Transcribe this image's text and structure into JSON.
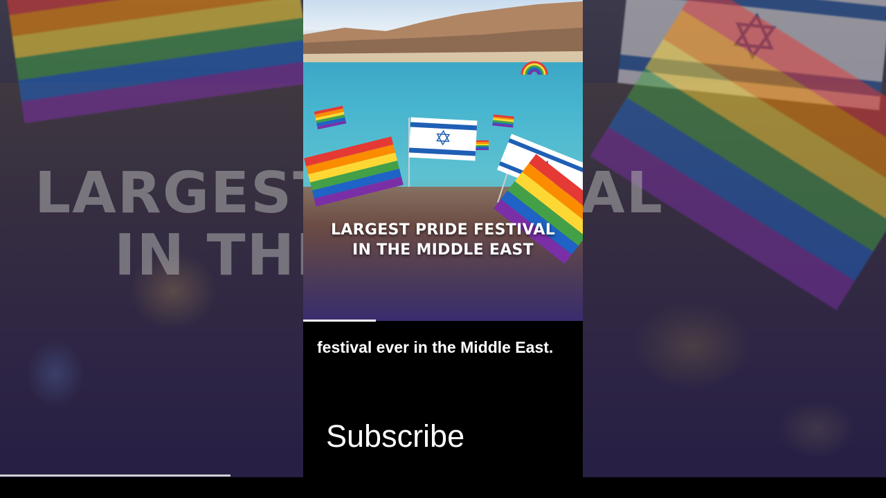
{
  "video": {
    "overlay_title_line1": "LARGEST PRIDE FESTIVAL",
    "overlay_title_line2": "IN THE MIDDLE EAST",
    "caption": "festival ever in the Middle East.",
    "subscribe_label": "Subscribe",
    "progress_fraction": 0.26,
    "outer_progress_fraction": 0.26
  },
  "background": {
    "line1": "LARGEST FESTIVAL",
    "line2": "IN THE EAST"
  },
  "colors": {
    "rainbow": [
      "#e53935",
      "#fb8c00",
      "#fdd835",
      "#43a047",
      "#1e63c5",
      "#7b2fa6"
    ],
    "israel_blue": "#1f5fb5"
  },
  "icons": {
    "star": "✡"
  }
}
